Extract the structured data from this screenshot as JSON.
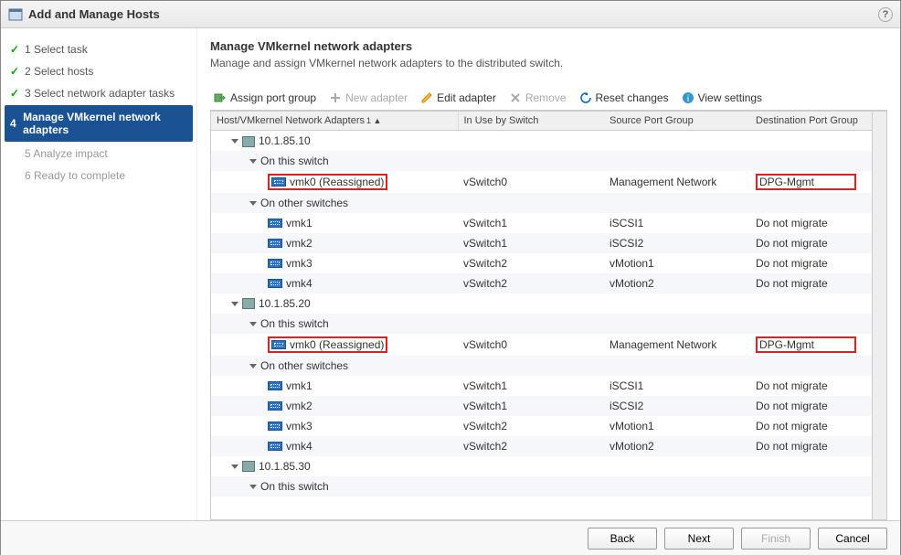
{
  "title": "Add and Manage Hosts",
  "steps": [
    {
      "label": "1  Select task",
      "done": true
    },
    {
      "label": "2  Select hosts",
      "done": true
    },
    {
      "label": "3  Select network adapter tasks",
      "done": true
    },
    {
      "label": "Manage VMkernel network adapters",
      "active": true,
      "num": "4"
    },
    {
      "label": "5  Analyze impact",
      "inactive": true
    },
    {
      "label": "6  Ready to complete",
      "inactive": true
    }
  ],
  "heading": "Manage VMkernel network adapters",
  "subheading": "Manage and assign VMkernel network adapters to the distributed switch.",
  "toolbar": {
    "assign": "Assign port group",
    "new": "New adapter",
    "edit": "Edit adapter",
    "remove": "Remove",
    "reset": "Reset changes",
    "view": "View settings"
  },
  "cols": {
    "c1": "Host/VMkernel Network Adapters",
    "c2": "In Use by Switch",
    "c3": "Source Port Group",
    "c4": "Destination Port Group",
    "sort": "1 ▲"
  },
  "labels": {
    "onthis": "On this switch",
    "onother": "On other switches",
    "donot": "Do not migrate",
    "mgmt": "Management Network",
    "dpg": "DPG-Mgmt",
    "reas": "vmk0 (Reassigned)"
  },
  "hosts": [
    {
      "ip": "10.1.85.10",
      "vmks": [
        {
          "n": "vmk1",
          "sw": "vSwitch1",
          "spg": "iSCSI1"
        },
        {
          "n": "vmk2",
          "sw": "vSwitch1",
          "spg": "iSCSI2"
        },
        {
          "n": "vmk3",
          "sw": "vSwitch2",
          "spg": "vMotion1"
        },
        {
          "n": "vmk4",
          "sw": "vSwitch2",
          "spg": "vMotion2"
        }
      ]
    },
    {
      "ip": "10.1.85.20",
      "vmks": [
        {
          "n": "vmk1",
          "sw": "vSwitch1",
          "spg": "iSCSI1"
        },
        {
          "n": "vmk2",
          "sw": "vSwitch1",
          "spg": "iSCSI2"
        },
        {
          "n": "vmk3",
          "sw": "vSwitch2",
          "spg": "vMotion1"
        },
        {
          "n": "vmk4",
          "sw": "vSwitch2",
          "spg": "vMotion2"
        }
      ]
    },
    {
      "ip": "10.1.85.30"
    }
  ],
  "sw0": "vSwitch0",
  "buttons": {
    "back": "Back",
    "next": "Next",
    "finish": "Finish",
    "cancel": "Cancel"
  }
}
